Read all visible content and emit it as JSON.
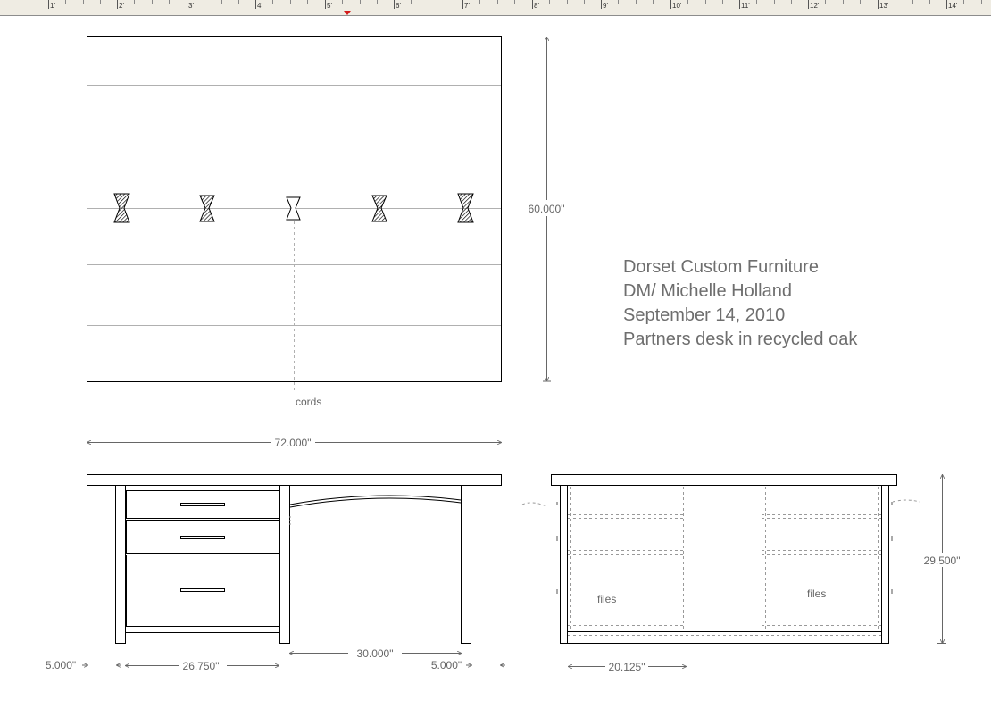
{
  "ruler": {
    "labels": [
      "1'",
      "2'",
      "3'",
      "4'",
      "5'",
      "6'",
      "7'",
      "8'",
      "9'",
      "10'",
      "11'",
      "12'",
      "13'",
      "14'"
    ]
  },
  "title_block": {
    "line1": "Dorset Custom Furniture",
    "line2": "DM/ Michelle Holland",
    "line3": "September 14, 2010",
    "line4": "Partners desk in recycled oak"
  },
  "dimensions": {
    "depth": "60.000\"",
    "width": "72.000\"",
    "height": "29.500\"",
    "pedestal_width": "26.750\"",
    "knee_width": "30.000\"",
    "end_overhang_left": "5.000\"",
    "end_overhang_right": "5.000\"",
    "side_depth": "20.125\""
  },
  "labels": {
    "cords": "cords",
    "files_left": "files",
    "files_right": "files"
  },
  "colors": {
    "line": "#000000",
    "plank_seam": "#b0b0b0",
    "dimension": "#666666",
    "ruler_marker": "#d21a1a"
  }
}
